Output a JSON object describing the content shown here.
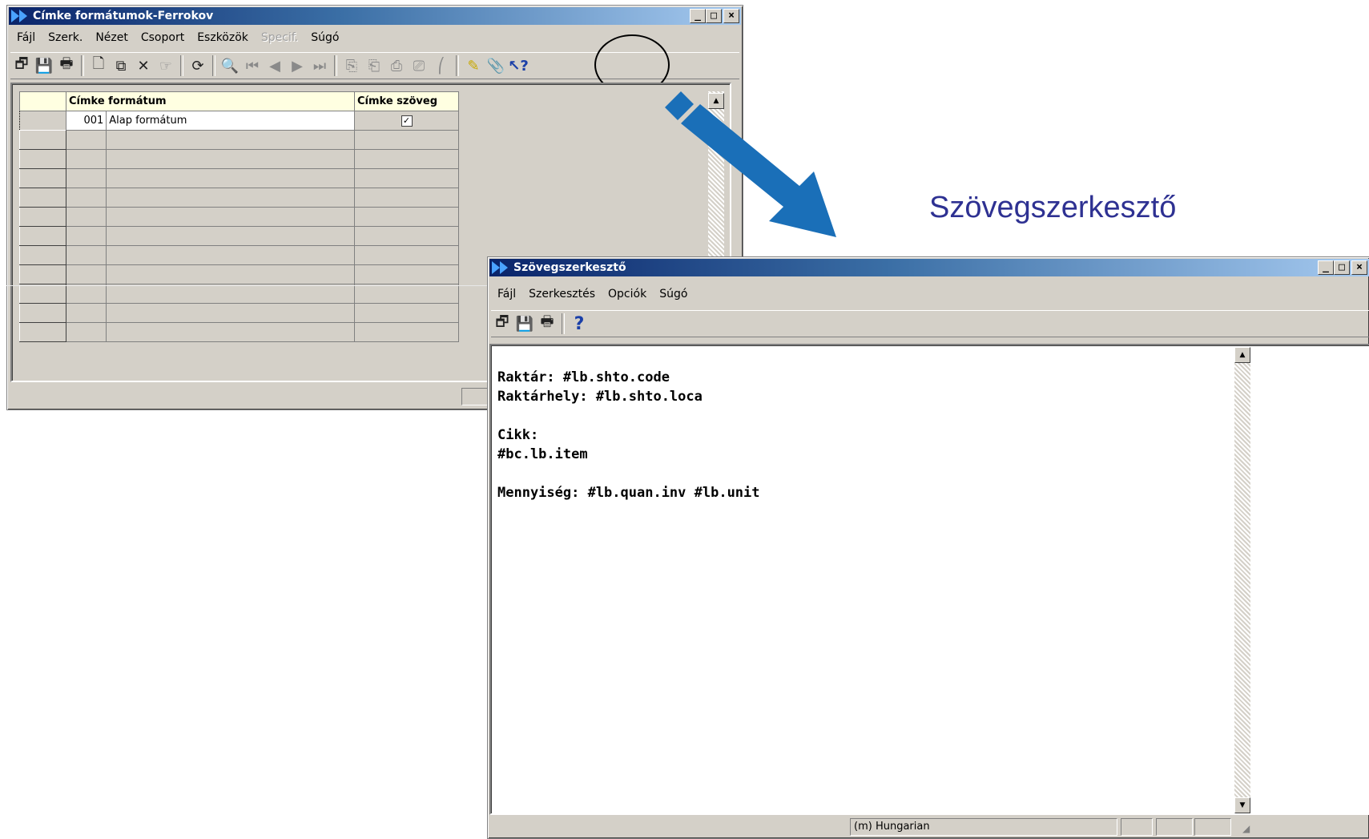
{
  "win1": {
    "title": "Címke formátumok-Ferrokov",
    "menu": [
      "Fájl",
      "Szerk.",
      "Nézet",
      "Csoport",
      "Eszközök",
      "Specif.",
      "Súgó"
    ],
    "menu_disabled_index": 5,
    "table": {
      "headers": [
        "Címke formátum",
        "Címke szöveg"
      ],
      "rows": [
        {
          "code": "001",
          "name": "Alap formátum",
          "checked": true
        }
      ],
      "empty_rows": 11
    }
  },
  "annotation": {
    "label": "Szövegszerkesztő"
  },
  "win2": {
    "title": "Szövegszerkesztő",
    "menu": [
      "Fájl",
      "Szerkesztés",
      "Opciók",
      "Súgó"
    ],
    "editor_lines": [
      "Raktár: #lb.shto.code",
      "Raktárhely: #lb.shto.loca",
      "",
      "Cikk:",
      "#bc.lb.item",
      "",
      "Mennyiség: #lb.quan.inv #lb.unit"
    ],
    "status": "(m) Hungarian"
  },
  "colors": {
    "titlebar_start": "#0a246a",
    "titlebar_end": "#a6caf0",
    "arrow": "#1a6fb8",
    "label": "#2e3192",
    "highlight_circle": "#000000"
  }
}
